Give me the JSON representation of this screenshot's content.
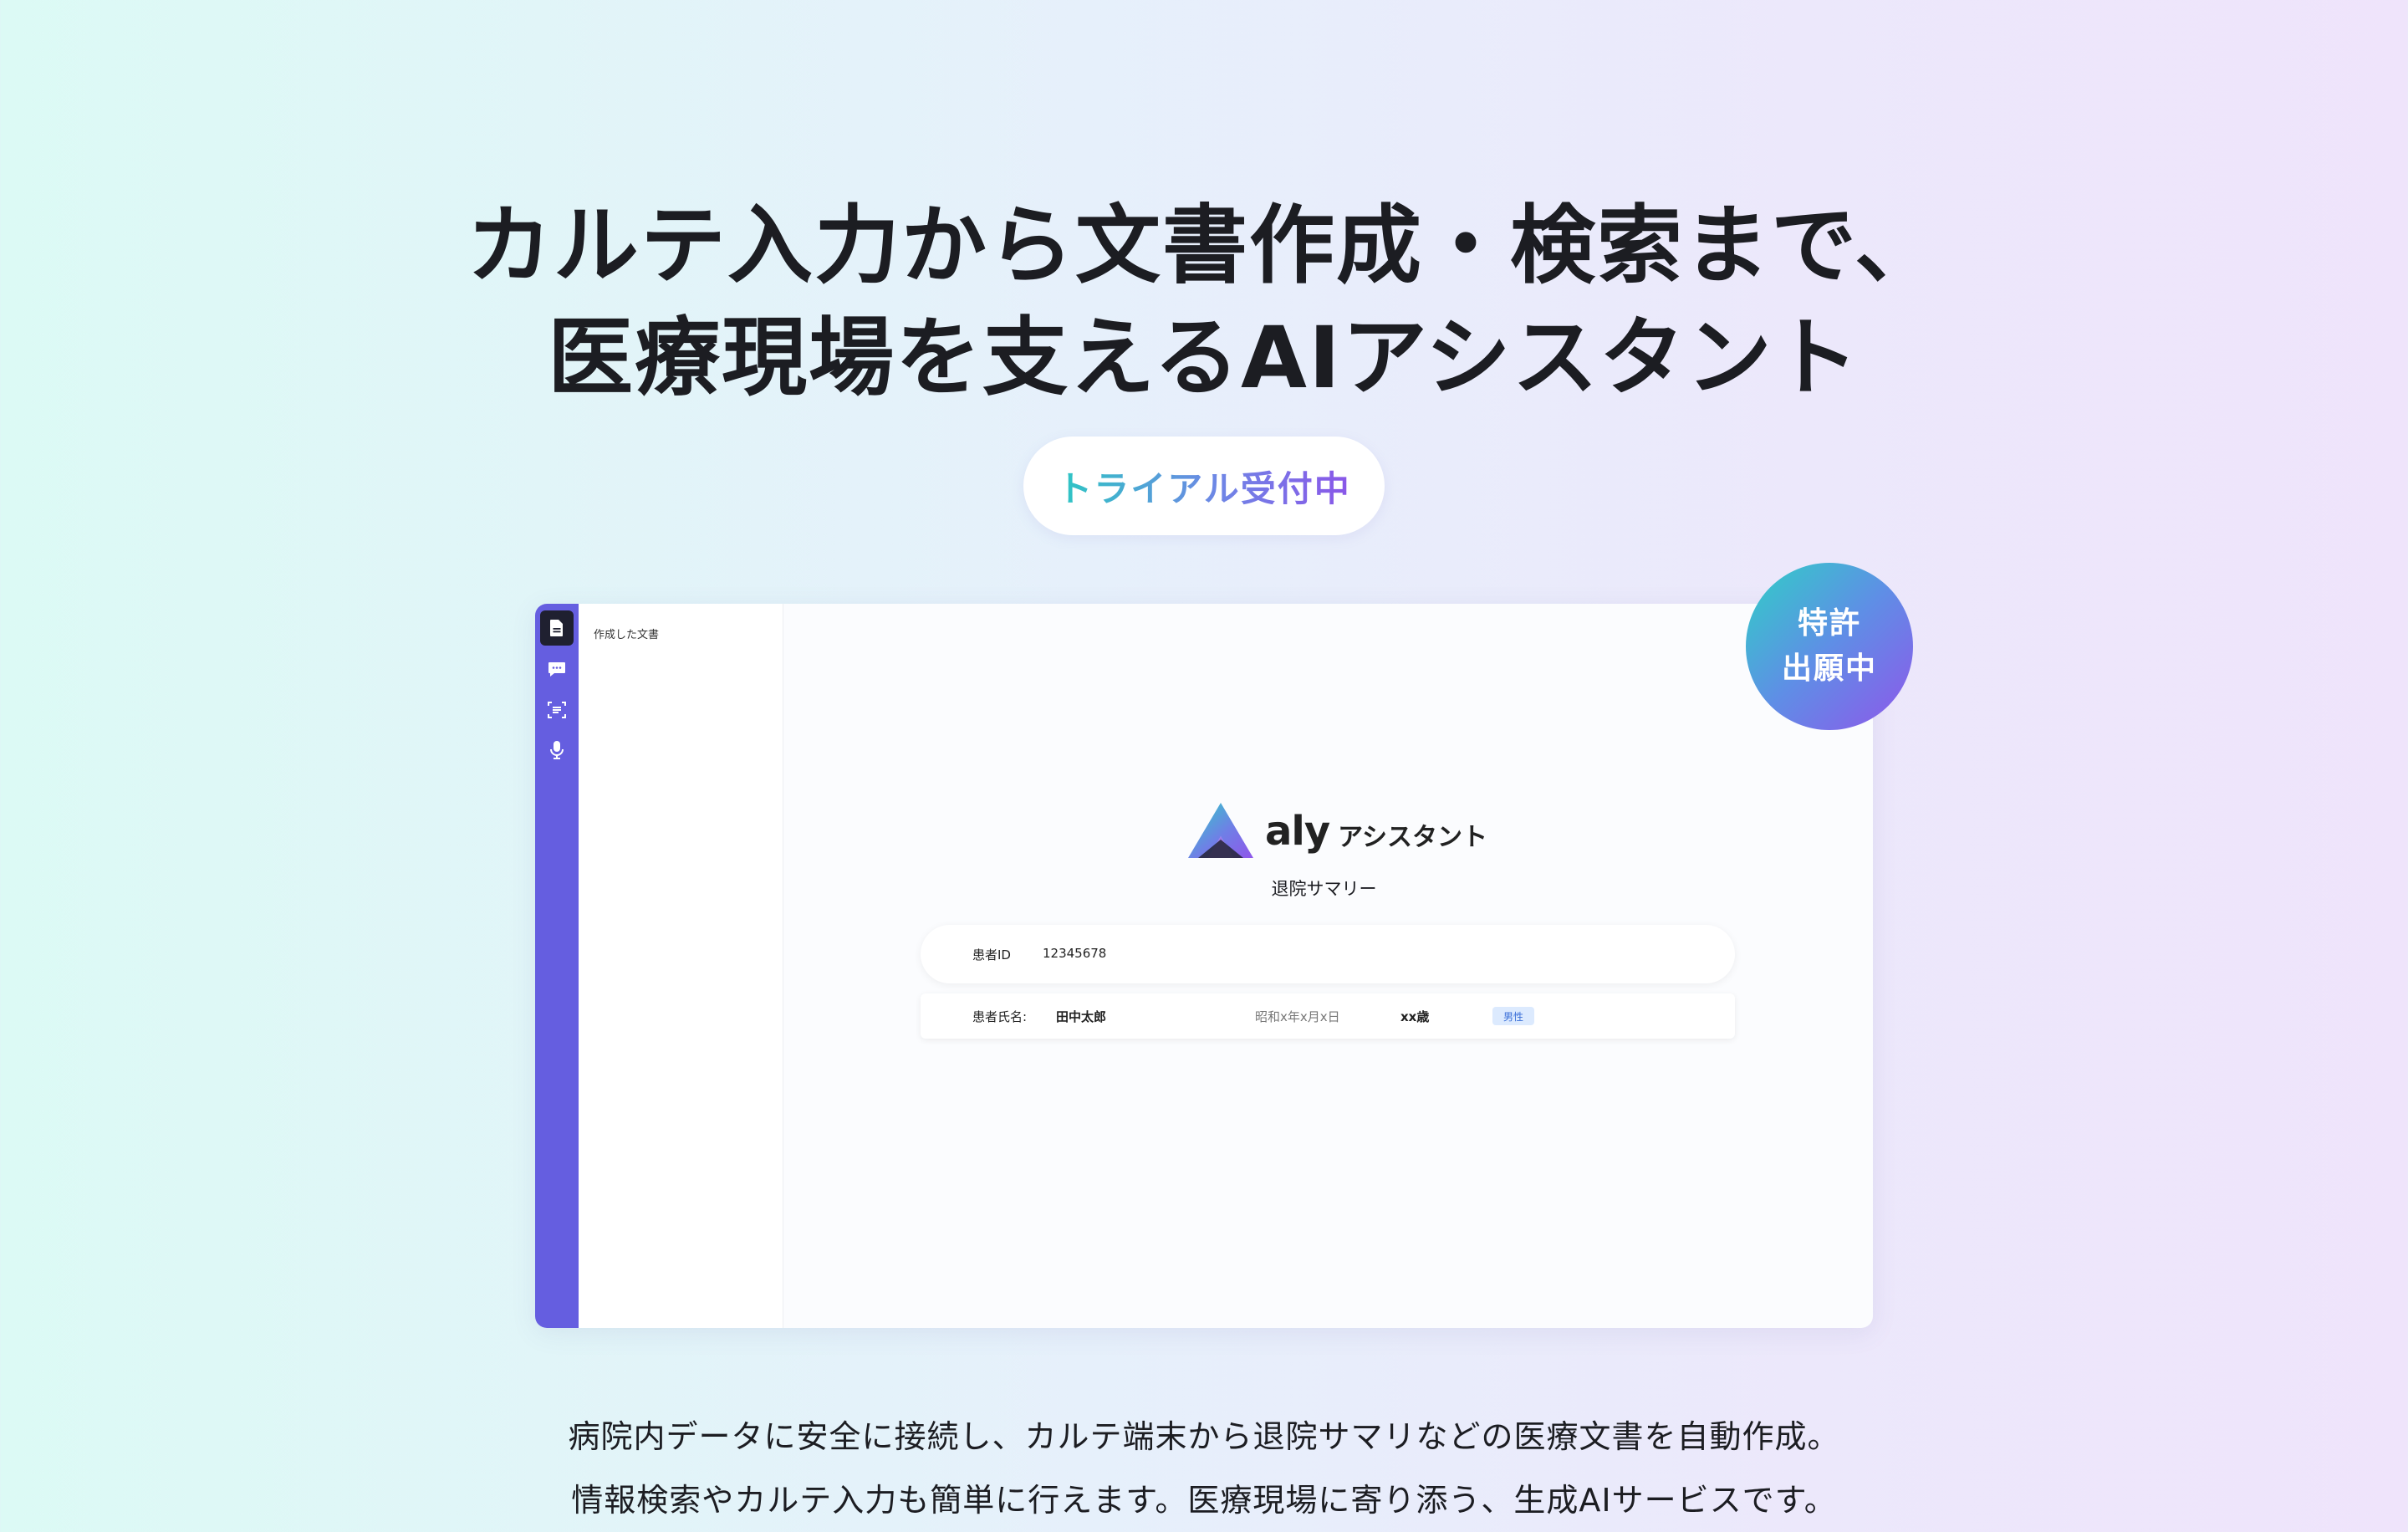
{
  "hero": {
    "headline_line1": "カルテ入力から文書作成・検索まで、",
    "headline_line2": "医療現場を支えるAIアシスタント",
    "trial_label": "トライアル受付中"
  },
  "patent_badge": {
    "line1": "特許",
    "line2": "出願中"
  },
  "app": {
    "rail_icons": [
      "document-icon",
      "chat-icon",
      "scan-text-icon",
      "microphone-icon"
    ],
    "doc_panel_title": "作成した文書",
    "logo_word": "aly",
    "logo_sub": "アシスタント",
    "document_title": "退院サマリー",
    "patient": {
      "id_label": "患者ID",
      "id_value": "12345678",
      "name_label": "患者氏名:",
      "name_value": "田中太郎",
      "birthdate": "昭和x年x月x日",
      "age": "xx歳",
      "sex": "男性"
    }
  },
  "description": {
    "line1": "病院内データに安全に接続し、カルテ端末から退院サマリなどの医療文書を自動作成。",
    "line2": "情報検索やカルテ入力も簡単に行えます。医療現場に寄り添う、生成AIサービスです。"
  },
  "colors": {
    "rail": "#655ee0",
    "accent_teal": "#2cc7c3",
    "accent_purple": "#8a56e8"
  }
}
